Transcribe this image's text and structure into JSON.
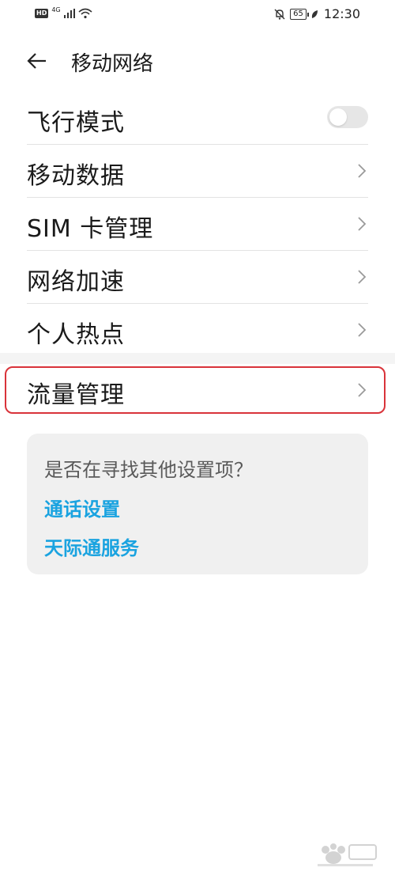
{
  "status_bar": {
    "hd": "HD",
    "network_type": "4G",
    "battery": "65",
    "time": "12:30"
  },
  "header": {
    "title": "移动网络"
  },
  "menu": {
    "items": [
      {
        "label": "飞行模式",
        "control": "toggle",
        "toggle_on": false
      },
      {
        "label": "移动数据",
        "control": "chevron"
      },
      {
        "label": "SIM 卡管理",
        "control": "chevron"
      },
      {
        "label": "网络加速",
        "control": "chevron"
      },
      {
        "label": "个人热点",
        "control": "chevron"
      }
    ],
    "traffic": {
      "label": "流量管理",
      "control": "chevron"
    }
  },
  "suggestions": {
    "title": "是否在寻找其他设置项？",
    "links": [
      "通话设置",
      "天际通服务"
    ]
  },
  "colors": {
    "link": "#1aa3e0",
    "highlight": "#d9333a",
    "card_bg": "#f0f0f0"
  }
}
